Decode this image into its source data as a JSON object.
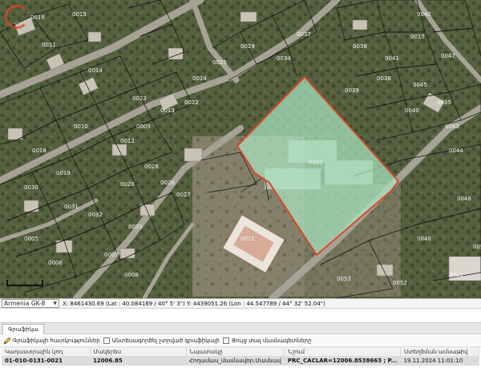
{
  "map": {
    "parcel_labels": [
      "0016",
      "0015",
      "0014",
      "0011",
      "0010",
      "0009",
      "0012",
      "0013",
      "0018",
      "0019",
      "0020",
      "0021",
      "0017",
      "0047",
      "0045",
      "0035",
      "0036",
      "0040",
      "0043",
      "0001",
      "0022",
      "0023",
      "0024",
      "0025",
      "0030",
      "0031",
      "0032",
      "0033",
      "0005",
      "0006",
      "0007",
      "0008",
      "0026",
      "0027",
      "0028",
      "0029",
      "0034",
      "0037",
      "0038",
      "0039",
      "0041",
      "0042",
      "0044",
      "0046",
      "0048",
      "0050",
      "0051",
      "0052",
      "0053"
    ],
    "selected_parcel_label": "0021",
    "selected_fill": "#a9e4c0",
    "selected_stroke": "#d9482a",
    "scale_label": ""
  },
  "coord_bar": {
    "crs": "Armenia GK-8",
    "coordinates": "X: 8461430.69 (Lat : 40.084169 / 40° 5' 3\") Y: 4439051.26 (Lon : 44.547789 / 44° 32' 52.04\")"
  },
  "panel": {
    "tab_label": "Գրաֆիկա",
    "toolbar": {
      "edit_label": "Գրաֆիկայի հատկություններ",
      "check1_label": "Անտեսագործել չտրված գրաֆիկայի",
      "check2_label": "Ցույց տալ մասնագետները"
    },
    "table": {
      "headers": [
        "Կադաստրային կոդ",
        "Մակերես",
        "Նպատակը",
        "Նշում",
        "Ստեղծման ամսաթիվ"
      ],
      "rows": [
        [
          "01-010-0131-0021",
          "12006.85",
          "Հողամաս_մասնավոր.Մասնավ",
          "PRC_CACLAR=12006.8538663 ; P...",
          "19.11.2024 11:01:10"
        ]
      ]
    }
  }
}
